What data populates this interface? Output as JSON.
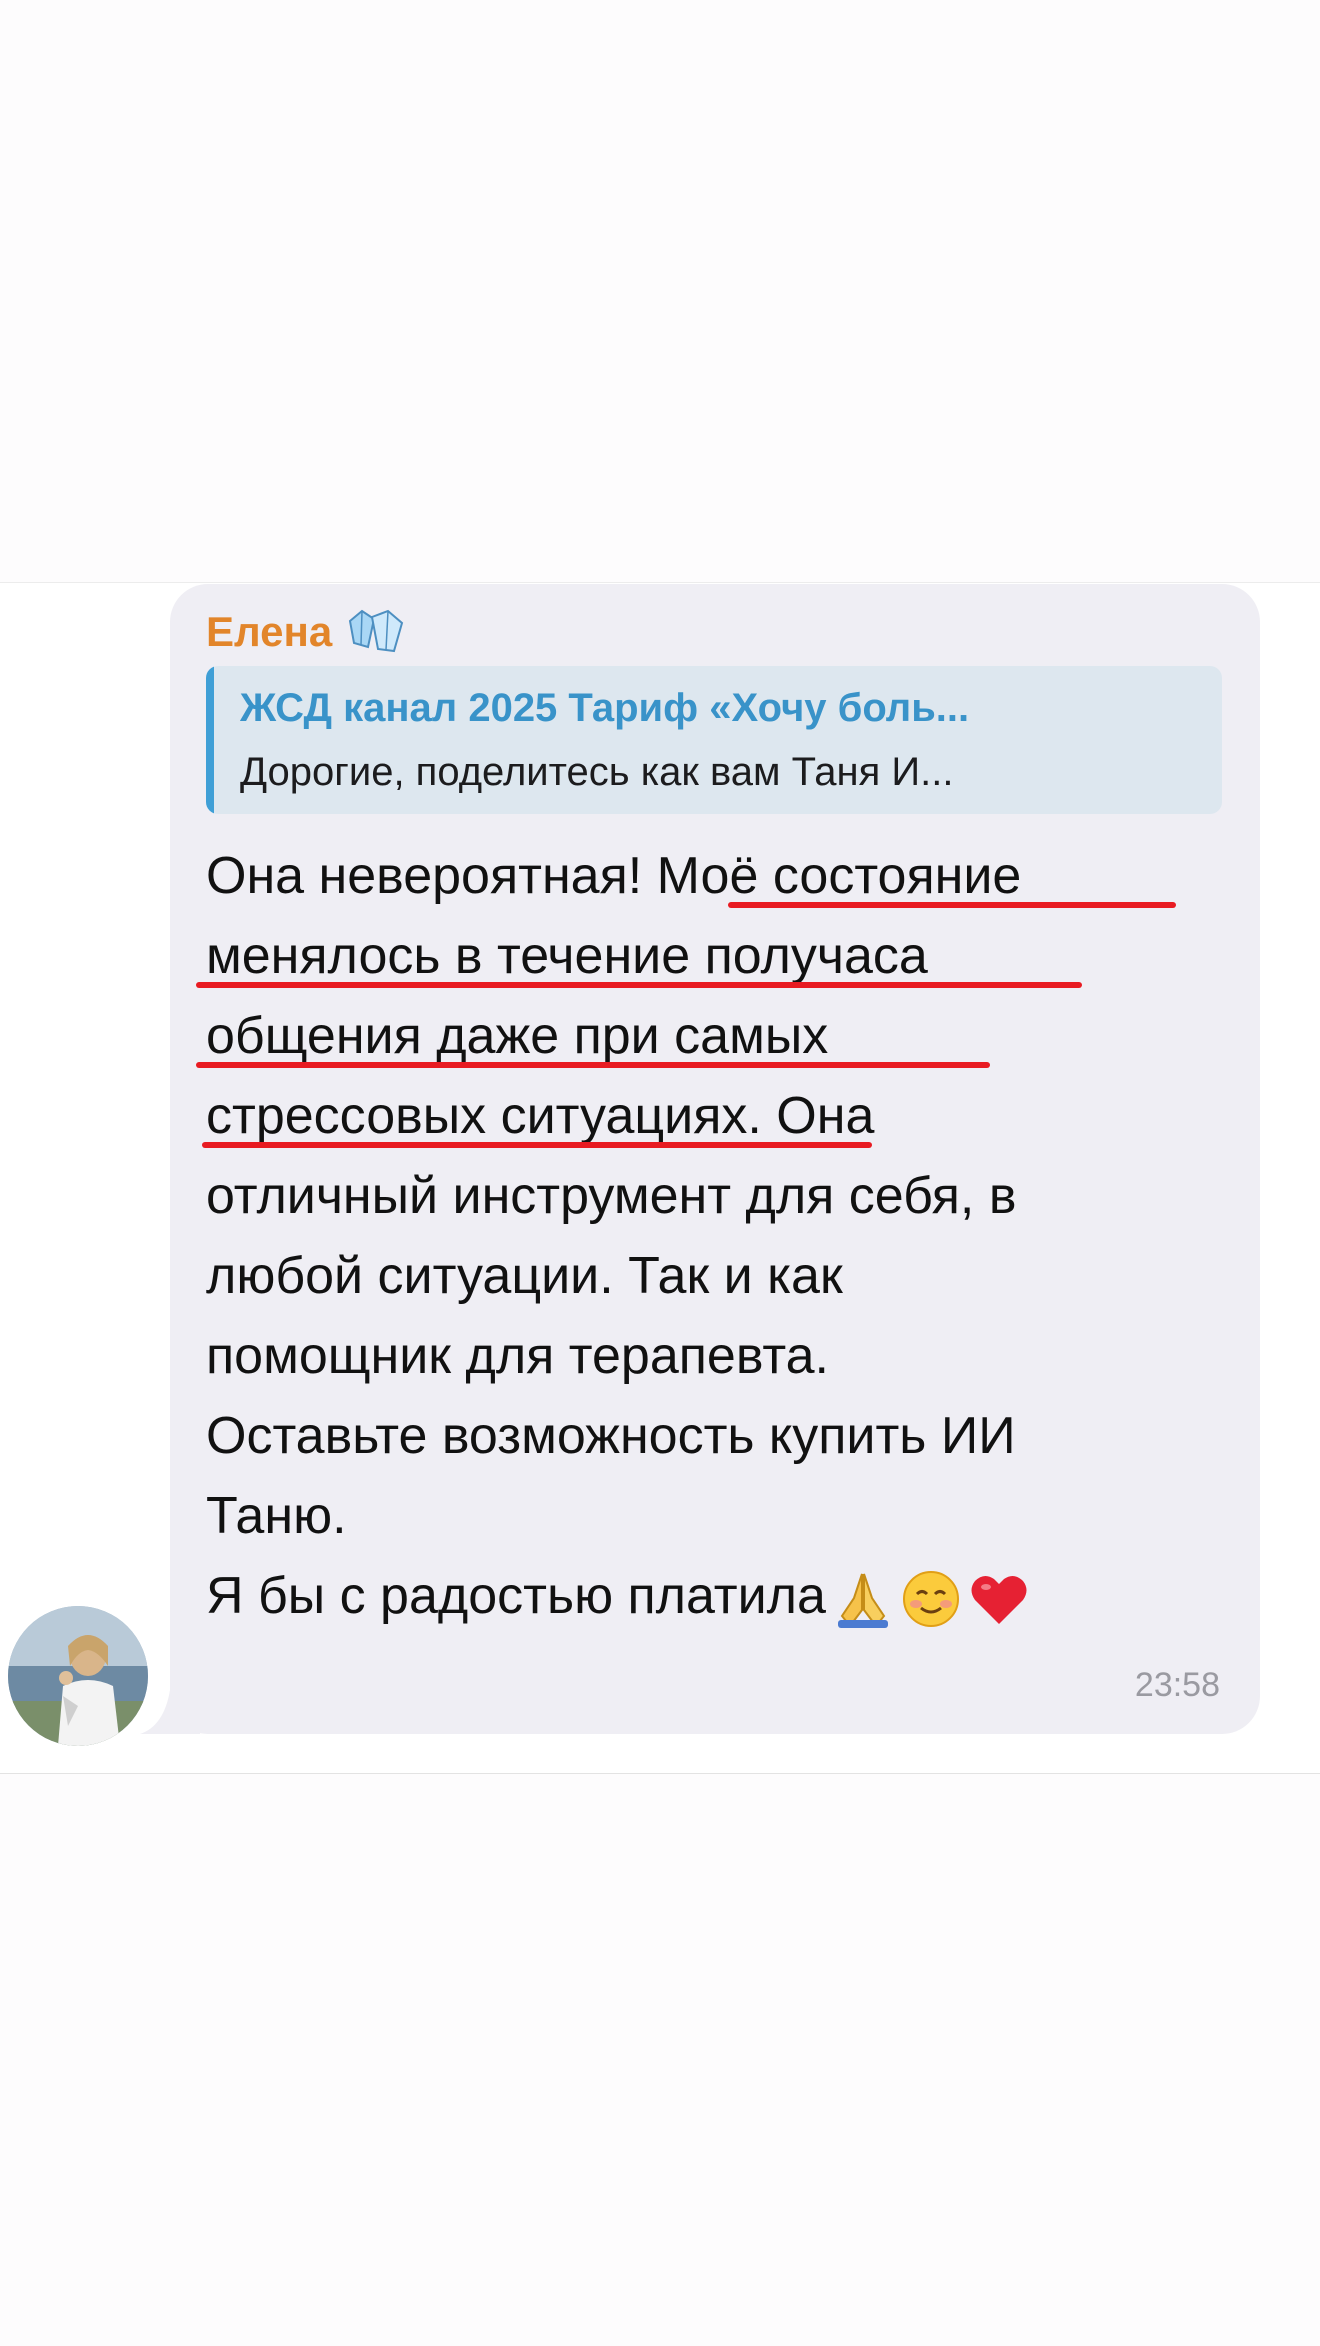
{
  "message": {
    "sender": "Елена",
    "sender_badge_icon": "gem-crystals-icon",
    "reply": {
      "title": "ЖСД канал 2025 Тариф «Хочу боль...",
      "text": "Дорогие, поделитесь как вам Таня И..."
    },
    "lines": [
      "Она невероятная! Моё состояние",
      "менялось в течение получаса",
      "общения даже при самых",
      "стрессовых ситуациях. Она",
      "отличный инструмент для себя, в",
      "любой ситуации. Так и как",
      "помощник для терапевта.",
      "Оставьте возможность купить ИИ",
      "Таню.",
      "Я бы с радостью платила"
    ],
    "emojis": [
      "praying-hands-emoji",
      "smiling-face-emoji",
      "red-heart-emoji"
    ],
    "time": "23:58"
  },
  "colors": {
    "sender": "#e2852a",
    "reply_accent": "#3f9fd6",
    "underline": "#e81b22",
    "bubble": "#efeef4"
  }
}
